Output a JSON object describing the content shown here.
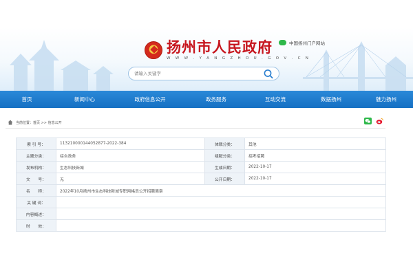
{
  "header": {
    "site_name": "扬州市人民政府",
    "site_url": "W W W . Y A N G Z H O U . G O V . C N",
    "portal_link": "中国扬州门户网站"
  },
  "search": {
    "placeholder": "请输入关键字"
  },
  "nav": {
    "items": [
      {
        "label": "首页"
      },
      {
        "label": "新闻中心"
      },
      {
        "label": "政府信息公开"
      },
      {
        "label": "政务服务"
      },
      {
        "label": "互动交流"
      },
      {
        "label": "数据扬州"
      },
      {
        "label": "魅力扬州"
      }
    ]
  },
  "breadcrumb": {
    "prefix": "当前位置：",
    "home": "首页",
    "separator": " >> ",
    "current": "信息公开"
  },
  "info": {
    "index_no_label": "索 引 号：",
    "index_no_value": "11321000014405287​7-2022-384",
    "category_label": "体裁分类：",
    "category_value": "其他",
    "topic_label": "主题分类：",
    "topic_value": "综合政务",
    "org_class_label": "组配分类：",
    "org_class_value": "招考招聘",
    "publisher_label": "发布机构：",
    "publisher_value": "生态科技新城",
    "created_label": "生成日期：",
    "created_value": "2022-10-17",
    "doc_no_label": "文　　号：",
    "doc_no_value": "无",
    "public_date_label": "公开日期：",
    "public_date_value": "2022-10-17",
    "name_label": "名　　称：",
    "name_value": "2022年10月扬州市生态科技新城专职网格员公开招聘简章",
    "keywords_label": "关 键 词：",
    "keywords_value": "",
    "summary_label": "内容概述：",
    "summary_value": "",
    "validity_label": "时　　效：",
    "validity_value": ""
  },
  "colors": {
    "brand_red": "#c7161e",
    "nav_blue": "#1a78cc"
  }
}
